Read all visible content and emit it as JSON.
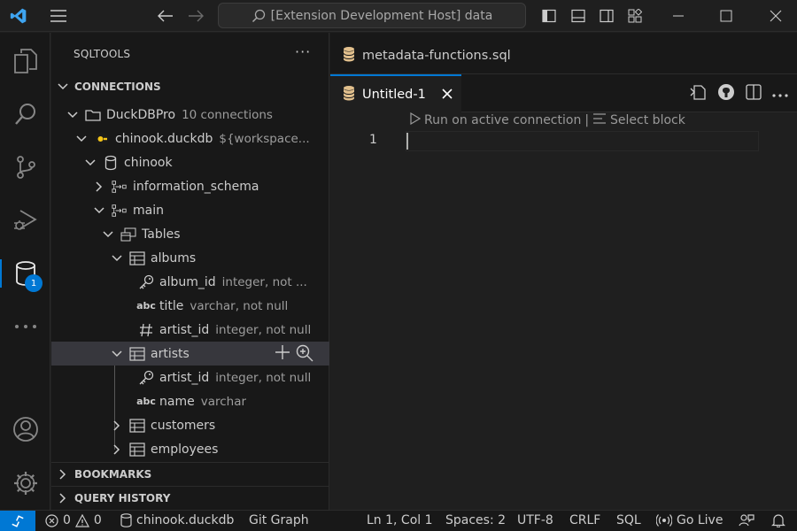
{
  "titlebar": {
    "search_text": "[Extension Development Host] data"
  },
  "activity": {
    "badge_count": "1"
  },
  "sidebar": {
    "title": "SQLTOOLS",
    "sections": {
      "connections": "CONNECTIONS",
      "bookmarks": "BOOKMARKS",
      "query_history": "QUERY HISTORY"
    },
    "tree": {
      "group": {
        "label": "DuckDBPro",
        "desc": "10 connections"
      },
      "connection": {
        "label": "chinook.duckdb",
        "desc": "${workspace..."
      },
      "database": {
        "label": "chinook"
      },
      "schema1": {
        "label": "information_schema"
      },
      "schema2": {
        "label": "main"
      },
      "tables": {
        "label": "Tables"
      },
      "albums": {
        "label": "albums"
      },
      "album_id": {
        "label": "album_id",
        "desc": "integer, not ..."
      },
      "title": {
        "label": "title",
        "desc": "varchar, not null"
      },
      "albums_artist_id": {
        "label": "artist_id",
        "desc": "integer, not null"
      },
      "artists": {
        "label": "artists"
      },
      "artists_artist_id": {
        "label": "artist_id",
        "desc": "integer, not null"
      },
      "name": {
        "label": "name",
        "desc": "varchar"
      },
      "customers": {
        "label": "customers"
      },
      "employees": {
        "label": "employees"
      },
      "abc_glyph": "abc"
    }
  },
  "editor": {
    "tab_inactive": "metadata-functions.sql",
    "tab_active": "Untitled-1",
    "codelens_run": "Run on active connection",
    "codelens_sep": "|",
    "codelens_select": "Select block",
    "line_number": "1"
  },
  "statusbar": {
    "errors": "0",
    "warnings": "0",
    "connection": "chinook.duckdb",
    "git_graph": "Git Graph",
    "position": "Ln 1, Col 1",
    "spaces": "Spaces: 2",
    "encoding": "UTF-8",
    "eol": "CRLF",
    "language": "SQL",
    "go_live": "Go Live"
  },
  "colors": {
    "accent": "#0078d4",
    "db_icon": "#e2c08d",
    "duck_icon": "#f5c518"
  }
}
